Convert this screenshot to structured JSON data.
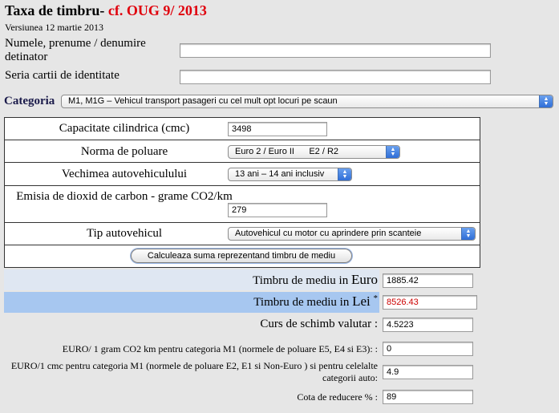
{
  "header": {
    "title": "Taxa de timbru-",
    "title_ref": "cf. OUG 9/ 2013",
    "version": "Versiunea 12 martie 2013"
  },
  "owner": {
    "name_label": "Numele, prenume / denumire detinator",
    "name_value": "",
    "id_label": "Seria cartii de identitate",
    "id_value": ""
  },
  "category": {
    "label": "Categoria",
    "selected": "M1, M1G – Vehicul transport pasageri cu cel mult opt locuri pe scaun"
  },
  "form": {
    "capacity_label": "Capacitate cilindrica (cmc)",
    "capacity_value": "3498",
    "norm_label": "Norma de poluare",
    "norm_selected": "Euro 2 / Euro II      E2 / R2",
    "age_label": "Vechimea autovehiculului",
    "age_selected": "13 ani – 14 ani inclusiv",
    "co2_label": "Emisia de dioxid de carbon  - grame CO2/km",
    "co2_value": "279",
    "type_label": "Tip autovehicul",
    "type_selected": "Autovehicul cu motor cu aprindere prin scanteie",
    "calc_button": "Calculeaza suma reprezentand timbru de mediu"
  },
  "results": {
    "euro_label": "Timbru de mediu in ",
    "euro_label_big": "Euro",
    "euro_value": "1885.42",
    "lei_label": "Timbru de mediu in ",
    "lei_label_big": "Lei",
    "lei_star": "*",
    "lei_value": "8526.43",
    "rate_label": "Curs de schimb valutar :",
    "rate_value": "4.5223",
    "co2_rate_label": "EURO/ 1 gram CO2 km pentru categoria M1 (normele de poluare E5, E4 si E3): :",
    "co2_rate_value": "0",
    "cmc_rate_label": "EURO/1 cmc pentru categoria M1 (normele de poluare E2, E1 si Non-Euro ) si pentru celelalte categorii auto:",
    "cmc_rate_value": "4.9",
    "discount_label": "Cota de reducere % :",
    "discount_value": "89"
  },
  "colors": {
    "title_red": "#e0000c",
    "lei_value_red": "#cc0000",
    "band_light": "#dfe7f2",
    "band_blue": "#a7c7f0"
  }
}
